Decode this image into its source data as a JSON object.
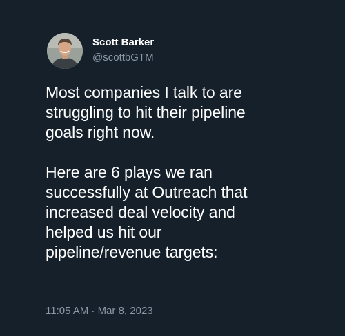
{
  "author": {
    "display_name": "Scott Barker",
    "handle": "@scottbGTM"
  },
  "tweet": {
    "paragraph_1": [
      "Most companies I talk to are",
      "struggling to hit their pipeline",
      "goals right now."
    ],
    "paragraph_2": [
      "Here are 6 plays we ran",
      "successfully at Outreach that",
      "increased deal velocity and",
      "helped us hit our",
      "pipeline/revenue targets:"
    ],
    "timestamp": "11:05 AM · Mar 8, 2023"
  },
  "colors": {
    "background": "#15202b",
    "primary_text": "#ffffff",
    "secondary_text": "#8b98a5"
  }
}
